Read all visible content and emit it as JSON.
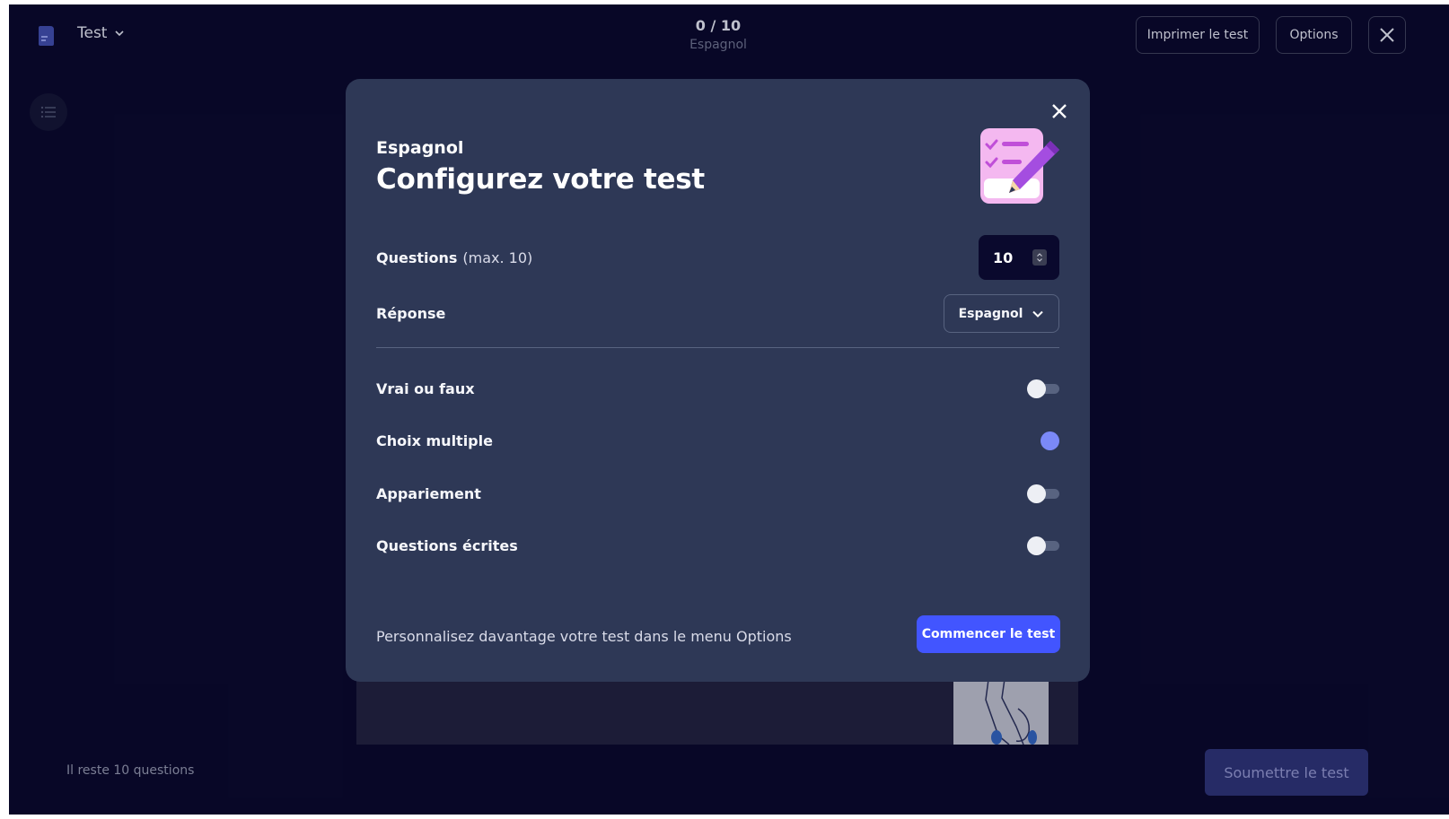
{
  "header": {
    "mode_label": "Test",
    "progress": "0 / 10",
    "set_name": "Espagnol",
    "print_label": "Imprimer le test",
    "options_label": "Options"
  },
  "footer": {
    "remaining": "Il reste 10 questions",
    "submit_label": "Soumettre le test"
  },
  "modal": {
    "subtitle": "Espagnol",
    "title": "Configurez votre test",
    "questions": {
      "label": "Questions",
      "hint": "(max. 10)",
      "value": "10"
    },
    "answer": {
      "label": "Réponse",
      "selected": "Espagnol"
    },
    "types": [
      {
        "label": "Vrai ou faux",
        "enabled": false
      },
      {
        "label": "Choix multiple",
        "enabled": true
      },
      {
        "label": "Appariement",
        "enabled": false
      },
      {
        "label": "Questions écrites",
        "enabled": false
      }
    ],
    "footer_hint": "Personnalisez davantage votre test dans le menu Options",
    "start_label": "Commencer le test"
  },
  "colors": {
    "background": "#0a092d",
    "modal": "#2e3856",
    "primary": "#4255ff",
    "toggle_on": "#7b89f7"
  }
}
